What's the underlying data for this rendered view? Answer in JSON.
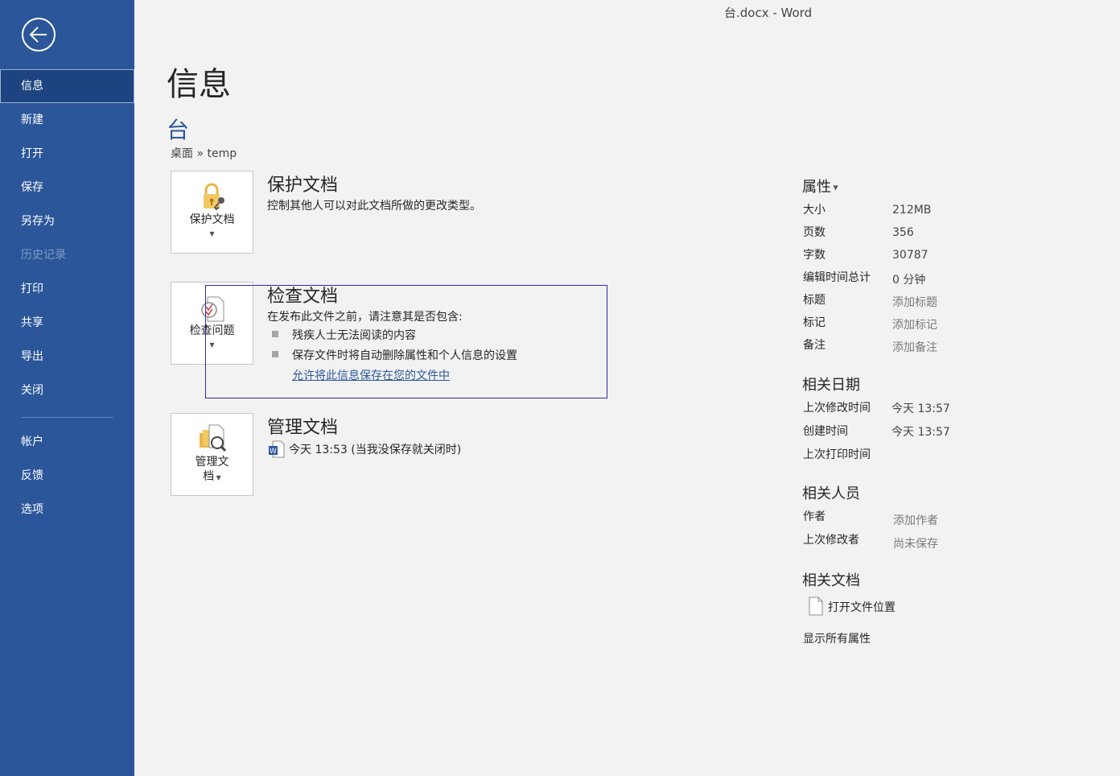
{
  "window": {
    "title": "台.docx  -  Word"
  },
  "sidebar": {
    "back_icon": "back-arrow-icon",
    "items": [
      {
        "label": "信息",
        "state": "active"
      },
      {
        "label": "新建",
        "state": "normal"
      },
      {
        "label": "打开",
        "state": "normal"
      },
      {
        "label": "保存",
        "state": "normal"
      },
      {
        "label": "另存为",
        "state": "normal"
      },
      {
        "label": "历史记录",
        "state": "disabled"
      },
      {
        "label": "打印",
        "state": "normal"
      },
      {
        "label": "共享",
        "state": "normal"
      },
      {
        "label": "导出",
        "state": "normal"
      },
      {
        "label": "关闭",
        "state": "normal"
      },
      {
        "label": "帐户",
        "state": "normal"
      },
      {
        "label": "反馈",
        "state": "normal"
      },
      {
        "label": "选项",
        "state": "normal"
      }
    ]
  },
  "main": {
    "page_title": "信息",
    "doc_name": "台",
    "doc_path": "桌面 » temp",
    "protect": {
      "tile_label": "保护文档",
      "title": "保护文档",
      "description": "控制其他人可以对此文档所做的更改类型。"
    },
    "inspect": {
      "tile_label": "检查问题",
      "title": "检查文档",
      "description": "在发布此文件之前，请注意其是否包含:",
      "bullets": [
        "残疾人士无法阅读的内容",
        "保存文件时将自动删除属性和个人信息的设置"
      ],
      "link": "允许将此信息保存在您的文件中"
    },
    "manage": {
      "tile_label_1": "管理文",
      "tile_label_2": "档",
      "title": "管理文档",
      "version": "今天 13:53 (当我没保存就关闭时)"
    }
  },
  "properties": {
    "header": "属性",
    "rows": [
      {
        "label": "大小",
        "value": "212MB"
      },
      {
        "label": "页数",
        "value": "356"
      },
      {
        "label": "字数",
        "value": "30787"
      },
      {
        "label": "编辑时间总计",
        "value": "0 分钟"
      },
      {
        "label": "标题",
        "value": "添加标题"
      },
      {
        "label": "标记",
        "value": "添加标记"
      },
      {
        "label": "备注",
        "value": "添加备注"
      }
    ],
    "dates_header": "相关日期",
    "dates": [
      {
        "label": "上次修改时间",
        "value": "今天 13:57"
      },
      {
        "label": "创建时间",
        "value": "今天 13:57"
      },
      {
        "label": "上次打印时间",
        "value": ""
      }
    ],
    "people_header": "相关人员",
    "people": [
      {
        "label": "作者",
        "value": "添加作者"
      },
      {
        "label": "上次修改者",
        "value": "尚未保存"
      }
    ],
    "docs_header": "相关文档",
    "open_location": "打开文件位置",
    "show_all": "显示所有属性"
  },
  "colors": {
    "sidebar": "#2b579a",
    "accent": "#2b579a",
    "background": "#f2f2f2"
  }
}
